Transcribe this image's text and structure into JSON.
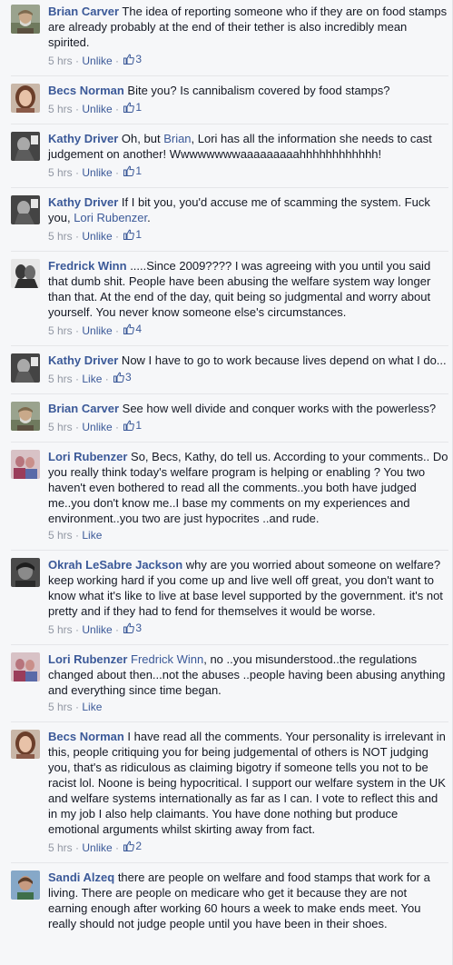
{
  "comments": [
    {
      "avatar": "brian-carver-avatar",
      "author": "Brian Carver",
      "segments": [
        {
          "text": " The idea of reporting someone who if they are on food stamps are already probably at the end of their tether is also incredibly mean spirited.",
          "mention": false
        }
      ],
      "time": "5 hrs",
      "like_label": "Unlike",
      "like_count": "3"
    },
    {
      "avatar": "becs-norman-avatar",
      "author": "Becs Norman",
      "segments": [
        {
          "text": " Bite you? Is cannibalism covered by food stamps?",
          "mention": false
        }
      ],
      "time": "5 hrs",
      "like_label": "Unlike",
      "like_count": "1"
    },
    {
      "avatar": "kathy-driver-avatar",
      "author": "Kathy Driver",
      "segments": [
        {
          "text": " Oh, but ",
          "mention": false
        },
        {
          "text": "Brian",
          "mention": true
        },
        {
          "text": ", Lori has all the information she needs to cast judgement on another! Wwwwwwwwaaaaaaaaahhhhhhhhhhhh!",
          "mention": false
        }
      ],
      "time": "5 hrs",
      "like_label": "Unlike",
      "like_count": "1"
    },
    {
      "avatar": "kathy-driver-avatar",
      "author": "Kathy Driver",
      "segments": [
        {
          "text": " If I bit you, you'd accuse me of scamming the system. Fuck you, ",
          "mention": false
        },
        {
          "text": "Lori Rubenzer",
          "mention": true
        },
        {
          "text": ".",
          "mention": false
        }
      ],
      "time": "5 hrs",
      "like_label": "Unlike",
      "like_count": "1"
    },
    {
      "avatar": "fredrick-winn-avatar",
      "author": "Fredrick Winn",
      "segments": [
        {
          "text": " .....Since 2009???? I was agreeing with you until you said that dumb shit. People have been abusing the welfare system way longer than that. At the end of the day, quit being so judgmental and worry about yourself. You never know someone else's circumstances.",
          "mention": false
        }
      ],
      "time": "5 hrs",
      "like_label": "Unlike",
      "like_count": "4"
    },
    {
      "avatar": "kathy-driver-avatar",
      "author": "Kathy Driver",
      "segments": [
        {
          "text": " Now I have to go to work because lives depend on what I do...",
          "mention": false
        }
      ],
      "time": "5 hrs",
      "like_label": "Like",
      "like_count": "3"
    },
    {
      "avatar": "brian-carver-avatar",
      "author": "Brian Carver",
      "segments": [
        {
          "text": " See how well divide and conquer works with the powerless?",
          "mention": false
        }
      ],
      "time": "5 hrs",
      "like_label": "Unlike",
      "like_count": "1"
    },
    {
      "avatar": "lori-rubenzer-avatar",
      "author": "Lori Rubenzer",
      "segments": [
        {
          "text": " So, Becs, Kathy, do tell us. According to your comments.. Do you really think today's welfare program is helping or enabling ? You two haven't even bothered to read all the comments..you both have judged me..you don't know me..I base my comments on my experiences and environment..you two are just hypocrites ..and rude.",
          "mention": false
        }
      ],
      "time": "5 hrs",
      "like_label": "Like",
      "like_count": ""
    },
    {
      "avatar": "okrah-lesabre-jackson-avatar",
      "author": "Okrah LeSabre Jackson",
      "segments": [
        {
          "text": " why are you worried about someone on welfare? keep working hard if you come up and live well off great, you don't want to know what it's like to live at base level supported by the government. it's not pretty and if they had to fend for themselves it would be worse.",
          "mention": false
        }
      ],
      "time": "5 hrs",
      "like_label": "Unlike",
      "like_count": "3"
    },
    {
      "avatar": "lori-rubenzer-avatar",
      "author": "Lori Rubenzer",
      "segments": [
        {
          "text": " ",
          "mention": false
        },
        {
          "text": "Fredrick Winn",
          "mention": true
        },
        {
          "text": ", no ..you misunderstood..the regulations changed about then...not the abuses ..people having been abusing anything and everything since time began.",
          "mention": false
        }
      ],
      "time": "5 hrs",
      "like_label": "Like",
      "like_count": ""
    },
    {
      "avatar": "becs-norman-avatar",
      "author": "Becs Norman",
      "segments": [
        {
          "text": " I have read all the comments. Your personality is irrelevant in this, people critiquing you for being judgemental of others is NOT judging you, that's as ridiculous as claiming bigotry if someone tells you not to be racist lol. Noone is being hypocritical. I support our welfare system in the UK and welfare systems internationally as far as I can. I vote to reflect this and in my job I also help claimants. You have done nothing but produce emotional arguments whilst skirting away from fact.",
          "mention": false
        }
      ],
      "time": "5 hrs",
      "like_label": "Unlike",
      "like_count": "2"
    },
    {
      "avatar": "sandi-alzeq-avatar",
      "author": "Sandi Alzeq",
      "segments": [
        {
          "text": " there are people on welfare and food stamps that work for a living. There are people on medicare who get it because they are not earning enough after working 60 hours a week to make ends meet. You really should not judge people until you have been in their shoes.",
          "mention": false
        }
      ],
      "time": "",
      "like_label": "",
      "like_count": ""
    }
  ],
  "separator": " · ",
  "colors": {
    "link": "#3b5998",
    "meta": "#9197a3",
    "text": "#141823",
    "background": "#f6f7f9"
  },
  "icons": {
    "like_count": "thumbs-up-icon"
  }
}
